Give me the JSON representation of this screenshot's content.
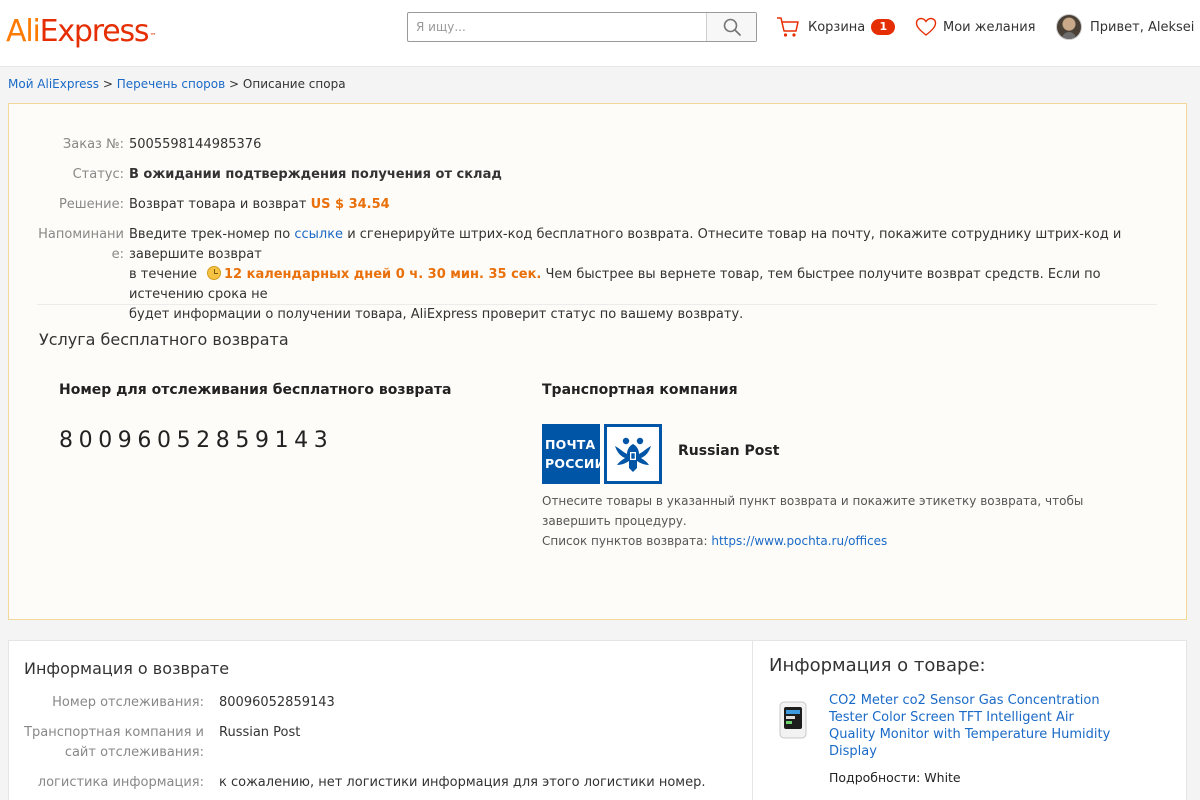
{
  "header": {
    "logo": {
      "part1": "Ali",
      "part2": "Express",
      "mark": "™"
    },
    "search": {
      "placeholder": "Я ищу...",
      "value": ""
    },
    "cart": {
      "label": "Корзина",
      "count": "1"
    },
    "wishlist": {
      "label": "Мои желания"
    },
    "user": {
      "greeting": "Привет, Aleksei"
    }
  },
  "breadcrumb": {
    "item1": "Мой AliExpress",
    "item2": "Перечень споров",
    "item3": "Описание спора",
    "sep": ">"
  },
  "dispute": {
    "order_label": "Заказ №:",
    "order_value": "5005598144985376",
    "status_label": "Статус:",
    "status_value": "В ожидании подтверждения получения от склад",
    "decision_label": "Решение:",
    "decision_text": "Возврат товара и возврат",
    "decision_amount": "US $ 34.54",
    "reminder_label_line1": "Напоминани",
    "reminder_label_line2": "е:",
    "reminder_pre": "Введите трек-номер по",
    "reminder_link": "ссылке",
    "reminder_mid": "и сгенерируйте штрих-код бесплатного возврата. Отнесите товар на почту, покажите сотруднику штрих-код и завершите возврат",
    "reminder_line2_pre": "в течение",
    "reminder_deadline": "12 календарных дней 0 ч. 30 мин. 35 сек.",
    "reminder_post": "Чем быстрее вы вернете товар, тем быстрее получите возврат средств. Если по истечению срока не",
    "reminder_line3": "будет информации о получении товара, AliExpress проверит статус по вашему возврату."
  },
  "free_return": {
    "title": "Услуга бесплатного возврата",
    "tracking_heading": "Номер для отслеживания бесплатного возврата",
    "tracking_number": "80096052859143",
    "carrier_heading": "Транспортная компания",
    "carrier_logo_line1": "ПОЧТА",
    "carrier_logo_line2": "РОССИИ",
    "carrier_name": "Russian Post",
    "carrier_note": "Отнесите товары в указанный пункт возврата и покажите этикетку возврата, чтобы завершить процедуру.",
    "carrier_list_label": "Список пунктов возврата:",
    "carrier_list_url": "https://www.pochta.ru/offices"
  },
  "return_info": {
    "title": "Информация о возврате",
    "tracking_label": "Номер отслеживания:",
    "tracking_value": "80096052859143",
    "carrier_label_line1": "Транспортная компания и",
    "carrier_label_line2": "сайт отслеживания:",
    "carrier_value": "Russian Post",
    "logistics_label": "логистика информация:",
    "logistics_value": "к сожалению, нет логистики информация для этого логистики номер."
  },
  "product_info": {
    "title": "Информация о товаре:",
    "product_name": "CO2 Meter co2 Sensor Gas Concentration Tester Color Screen TFT Intelligent Air Quality Monitor with Temperature Humidity Display",
    "details_label": "Подробности:",
    "details_value": "White"
  },
  "colors": {
    "brand_orange": "#ff7a00",
    "brand_red": "#e62e04",
    "link_blue": "#1a6ac7",
    "status_green": "#1b9a1b",
    "amount_orange": "#e9700b",
    "panel_border": "#f2d99a",
    "post_blue": "#0055a6"
  },
  "icons": {
    "search": "search-icon",
    "cart": "cart-icon",
    "wishlist": "heart-icon",
    "timer": "clock-icon",
    "carrier_emblem": "eagle-emblem-icon"
  }
}
